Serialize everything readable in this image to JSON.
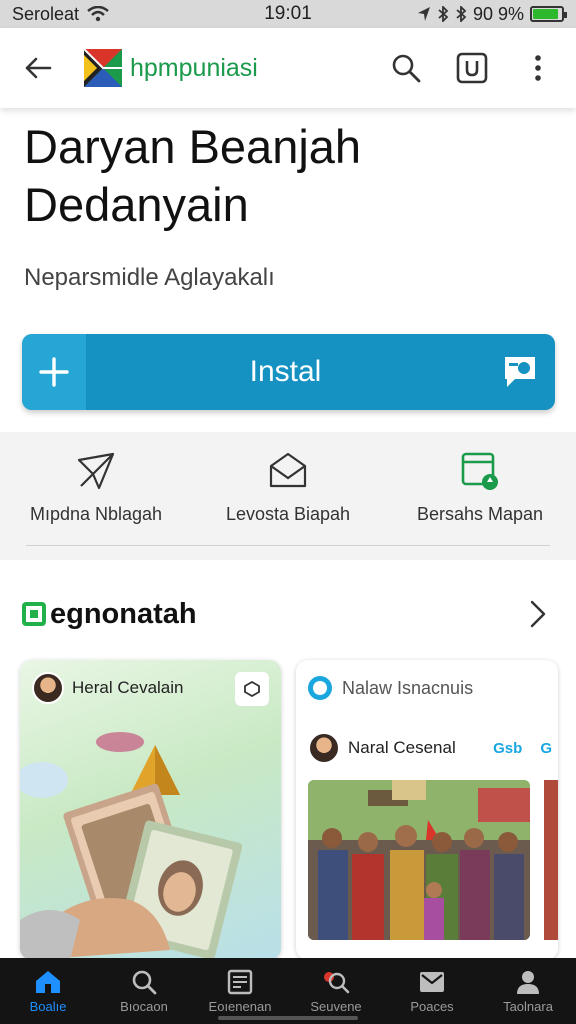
{
  "status_bar": {
    "carrier": "Seroleat",
    "time": "19:01",
    "battery_text": "90 9%",
    "battery_level": 0.9,
    "icons": [
      "wifi-icon",
      "location-icon",
      "bluetooth-icon",
      "bluetooth-icon",
      "battery-icon"
    ]
  },
  "app_bar": {
    "app_name": "hpmpuniasi",
    "actions": [
      "search-icon",
      "u-box-icon",
      "more-vertical-icon"
    ]
  },
  "header": {
    "title_line1": "Daryan Beanjah",
    "title_line2": "Dedanyain",
    "developer": "Neparsmidle Aglayakalı"
  },
  "install": {
    "label": "Instal",
    "accent": "#1591c2"
  },
  "features": [
    {
      "label": "Mıpdna Nblagah",
      "icon": "paper-plane-icon"
    },
    {
      "label": "Levosta Biapah",
      "icon": "envelope-icon"
    },
    {
      "label": "Bersahs Mapan",
      "icon": "document-badge-icon"
    }
  ],
  "section": {
    "title": "egnonatah",
    "accent": "#22b04a"
  },
  "cards": {
    "left": {
      "name": "Heral Cevalain"
    },
    "right": {
      "label": "Nalaw Isnacnuis",
      "name": "Naral Cesenal",
      "chips": [
        "Gsb",
        "G"
      ]
    }
  },
  "bottom_nav": [
    {
      "label": "Boalıe",
      "icon": "home-icon",
      "active": true
    },
    {
      "label": "Bıocaon",
      "icon": "search-icon",
      "active": false
    },
    {
      "label": "Eoıenenan",
      "icon": "media-icon",
      "active": false
    },
    {
      "label": "Seuvene",
      "icon": "search-badge-icon",
      "active": false
    },
    {
      "label": "Poaces",
      "icon": "inbox-icon",
      "active": false
    },
    {
      "label": "Taolnara",
      "icon": "person-icon",
      "active": false
    }
  ]
}
